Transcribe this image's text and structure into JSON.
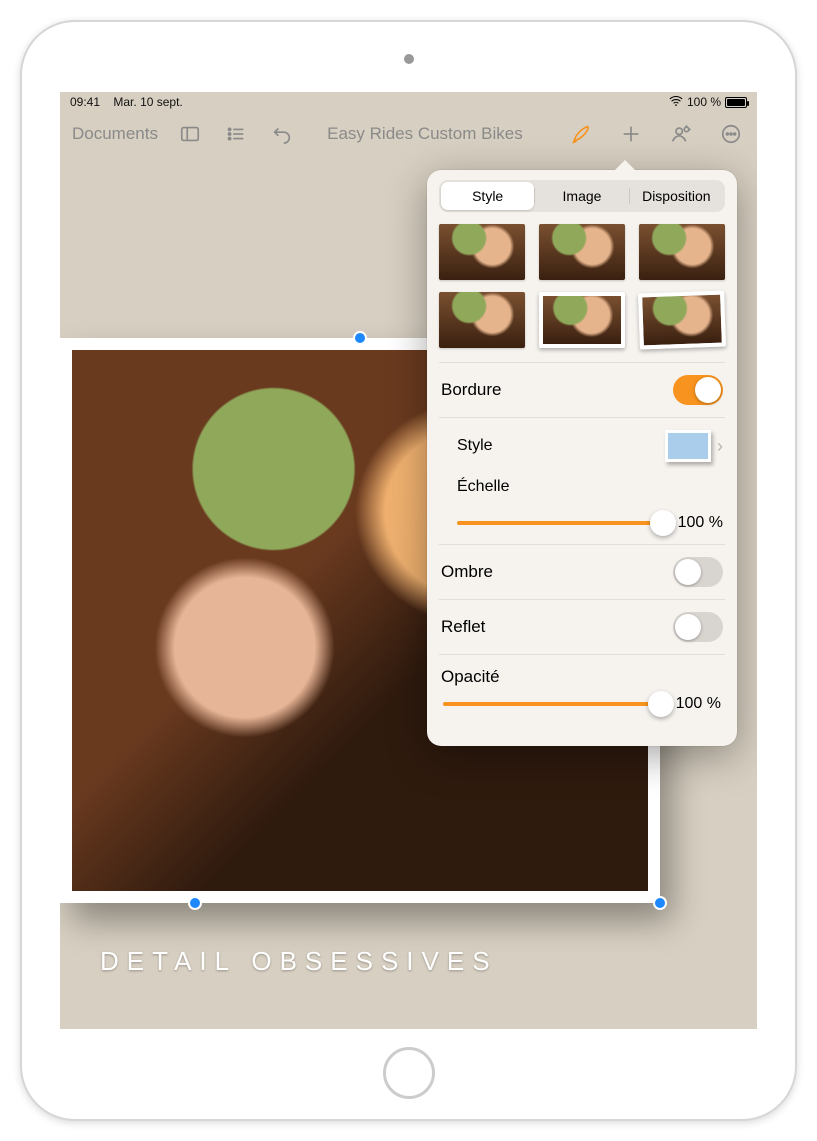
{
  "statusbar": {
    "time": "09:41",
    "date": "Mar. 10 sept.",
    "battery_pct": "100 %"
  },
  "toolbar": {
    "documents_label": "Documents",
    "title": "Easy Rides Custom Bikes"
  },
  "document": {
    "caption": "DETAIL OBSESSIVES"
  },
  "popover": {
    "tabs": {
      "style": "Style",
      "image": "Image",
      "disposition": "Disposition"
    },
    "border_label": "Bordure",
    "border_on": true,
    "style_label": "Style",
    "scale_label": "Échelle",
    "scale_value": "100 %",
    "shadow_label": "Ombre",
    "shadow_on": false,
    "reflect_label": "Reflet",
    "reflect_on": false,
    "opacity_label": "Opacité",
    "opacity_value": "100 %"
  }
}
